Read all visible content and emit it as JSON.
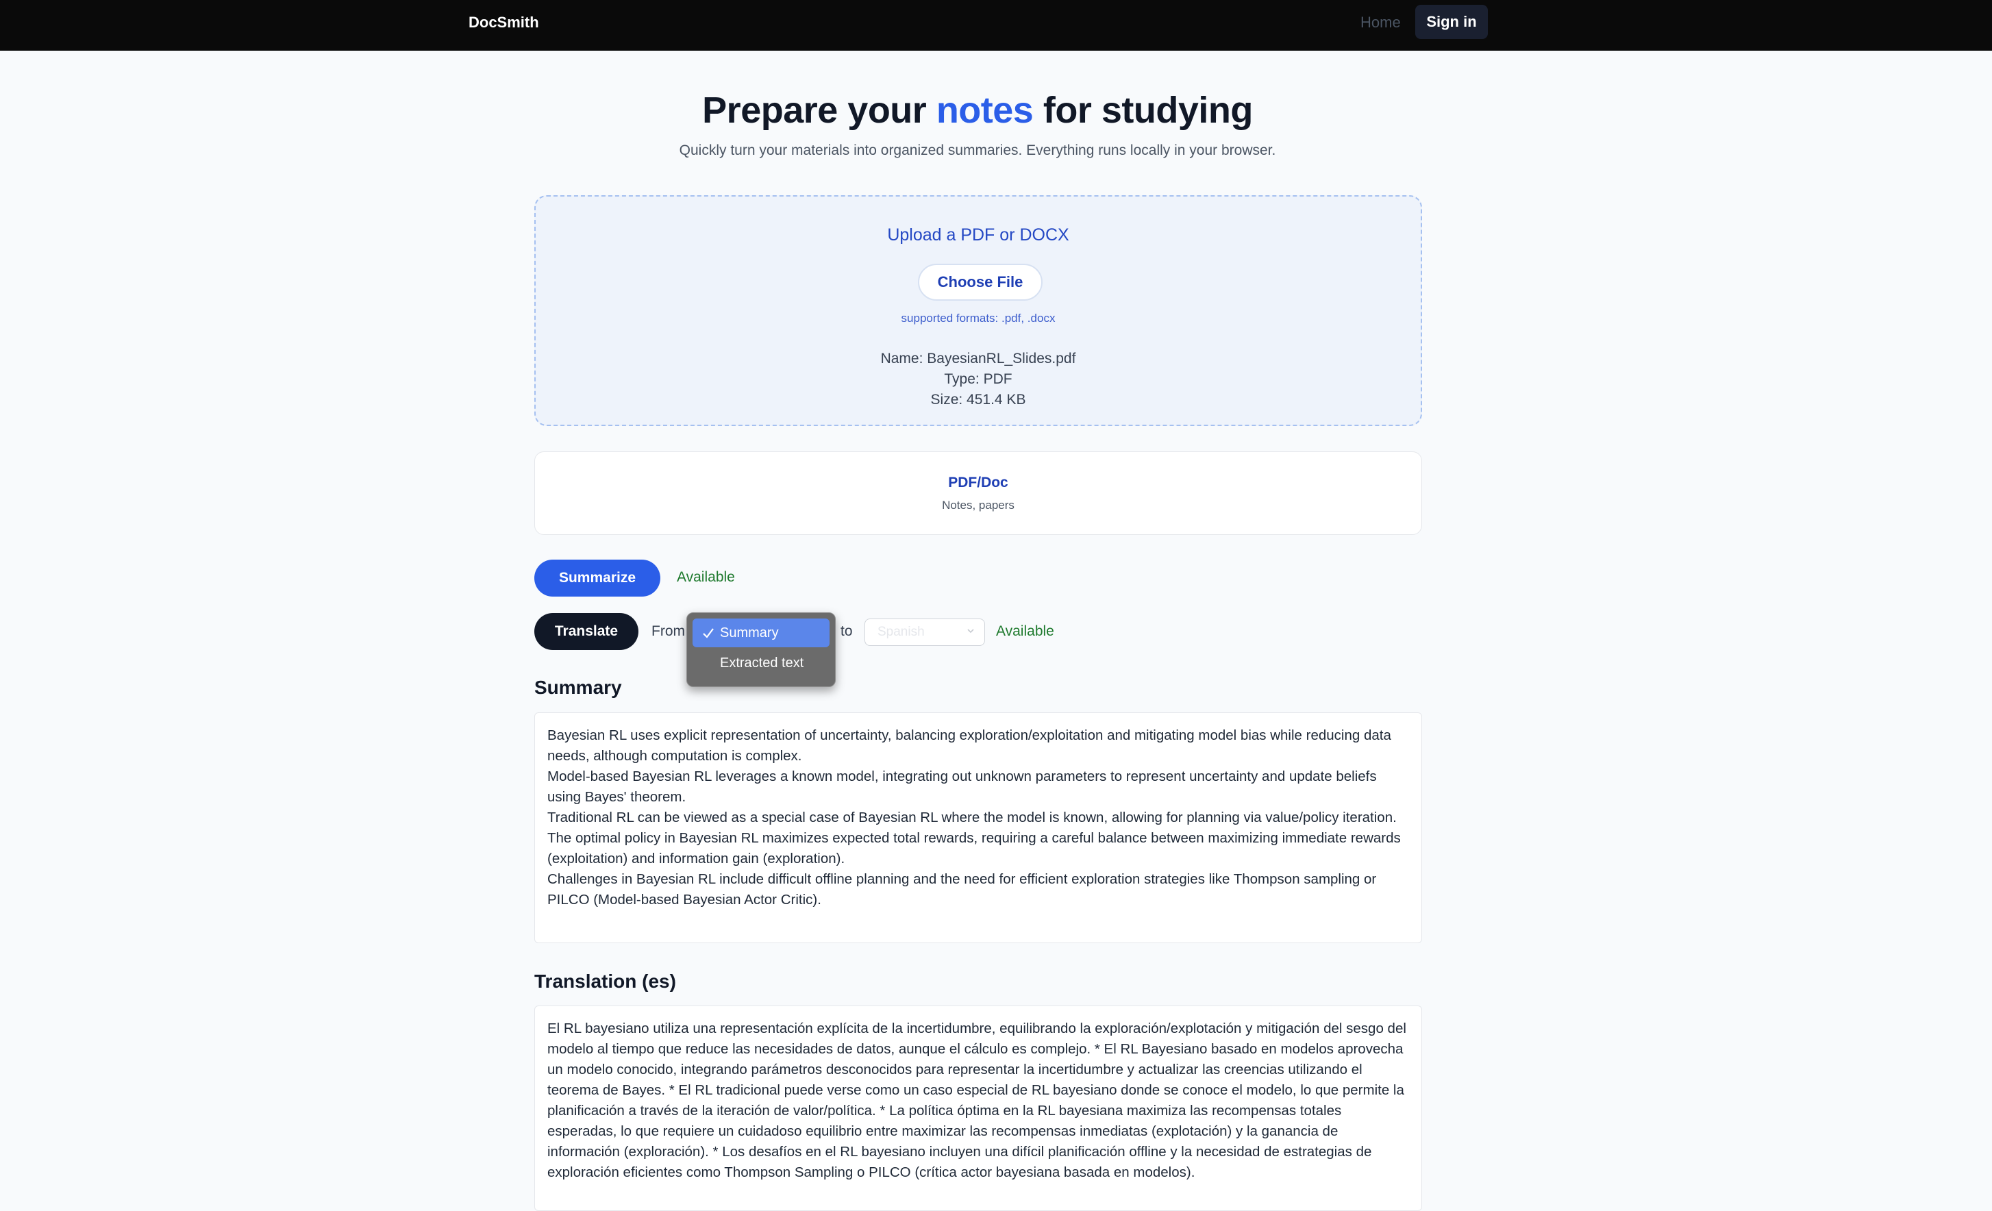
{
  "nav": {
    "brand": "DocSmith",
    "home": "Home",
    "sign_in": "Sign in"
  },
  "hero": {
    "title_pre": "Prepare your ",
    "title_accent": "notes",
    "title_post": " for studying",
    "subtitle": "Quickly turn your materials into organized summaries. Everything runs locally in your browser."
  },
  "upload": {
    "title": "Upload a PDF or DOCX",
    "choose_file": "Choose File",
    "formats": "supported formats: .pdf, .docx",
    "file_name": "Name: BayesianRL_Slides.pdf",
    "file_type": "Type: PDF",
    "file_size": "Size: 451.4 KB"
  },
  "source": {
    "title": "PDF/Doc",
    "subtitle": "Notes, papers"
  },
  "actions": {
    "summarize": "Summarize",
    "summarize_status": "Available",
    "translate": "Translate",
    "from_label": "From",
    "to_label": "to",
    "to_language": "Spanish",
    "translate_status": "Available",
    "from_options": [
      {
        "label": "Summary",
        "selected": true
      },
      {
        "label": "Extracted text",
        "selected": false
      }
    ]
  },
  "summary": {
    "heading": "Summary",
    "lines": [
      "Bayesian RL uses explicit representation of uncertainty, balancing exploration/exploitation and mitigating model bias while reducing data needs, although computation is complex.",
      "Model-based Bayesian RL leverages a known model, integrating out unknown parameters to represent uncertainty and update beliefs using Bayes' theorem.",
      "Traditional RL can be viewed as a special case of Bayesian RL where the model is known, allowing for planning via value/policy iteration.",
      "The optimal policy in Bayesian RL maximizes expected total rewards, requiring a careful balance between maximizing immediate rewards (exploitation) and information gain (exploration).",
      "Challenges in Bayesian RL include difficult offline planning and the need for efficient exploration strategies like Thompson sampling or PILCO (Model-based Bayesian Actor Critic)."
    ]
  },
  "translation": {
    "heading": "Translation (es)",
    "text": "El RL bayesiano utiliza una representación explícita de la incertidumbre, equilibrando la exploración/explotación y mitigación del sesgo del modelo al tiempo que reduce las necesidades de datos, aunque el cálculo es complejo. * El RL Bayesiano basado en modelos aprovecha un modelo conocido, integrando parámetros desconocidos para representar la incertidumbre y actualizar las creencias utilizando el teorema de Bayes. * El RL tradicional puede verse como un caso especial de RL bayesiano donde se conoce el modelo, lo que permite la planificación a través de la iteración de valor/política. * La política óptima en la RL bayesiana maximiza las recompensas totales esperadas, lo que requiere un cuidadoso equilibrio entre maximizar las recompensas inmediatas (explotación) y la ganancia de información (exploración). * Los desafíos en el RL bayesiano incluyen una difícil planificación offline y la necesidad de estrategias de exploración eficientes como Thompson Sampling o PILCO (crítica actor bayesiana basada en modelos)."
  },
  "colors": {
    "accent": "#2b5ee8",
    "nav_bg": "#0a0a0a",
    "status_green": "#1f7a2e",
    "dropdown_selected": "#5b86ea"
  }
}
